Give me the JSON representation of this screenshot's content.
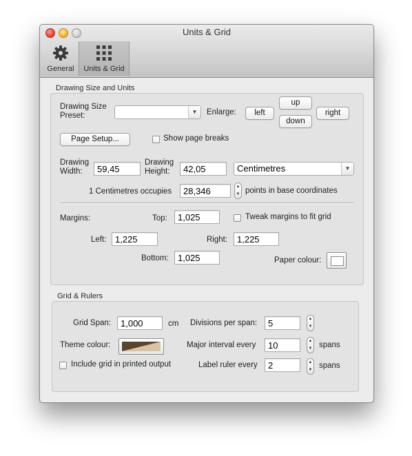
{
  "window": {
    "title": "Units & Grid"
  },
  "toolbar": {
    "items": [
      {
        "label": "General",
        "icon": "gear-icon"
      },
      {
        "label": "Units & Grid",
        "icon": "grid-icon",
        "selected": true
      }
    ]
  },
  "drawing": {
    "section_title": "Drawing Size and Units",
    "preset_label": "Drawing Size Preset:",
    "preset_value": "",
    "enlarge_label": "Enlarge:",
    "enlarge": {
      "up": "up",
      "left": "left",
      "right": "right",
      "down": "down"
    },
    "page_setup_label": "Page Setup...",
    "show_page_breaks_label": "Show page breaks",
    "show_page_breaks_checked": false,
    "width_label": "Drawing Width:",
    "width_value": "59,45",
    "height_label": "Drawing Height:",
    "height_value": "42,05",
    "units_value": "Centimetres",
    "occupies_label": "1 Centimetres occupies",
    "occupies_value": "28,346",
    "occupies_suffix": "points in base coordinates"
  },
  "margins": {
    "label": "Margins:",
    "top_label": "Top:",
    "top_value": "1,025",
    "left_label": "Left:",
    "left_value": "1,225",
    "right_label": "Right:",
    "right_value": "1,225",
    "bottom_label": "Bottom:",
    "bottom_value": "1,025",
    "tweak_label": "Tweak margins to fit grid",
    "tweak_checked": false,
    "paper_colour_label": "Paper colour:",
    "paper_colour": "#ffffff"
  },
  "grid": {
    "section_title": "Grid & Rulers",
    "span_label": "Grid Span:",
    "span_value": "1,000",
    "span_unit": "cm",
    "divisions_label": "Divisions per span:",
    "divisions_value": "5",
    "theme_label": "Theme colour:",
    "theme_colors": [
      "#5a4630",
      "#d9c2a8"
    ],
    "major_label": "Major interval every",
    "major_value": "10",
    "major_unit": "spans",
    "include_label": "Include grid in printed output",
    "include_checked": false,
    "ruler_label": "Label ruler every",
    "ruler_value": "2",
    "ruler_unit": "spans"
  }
}
